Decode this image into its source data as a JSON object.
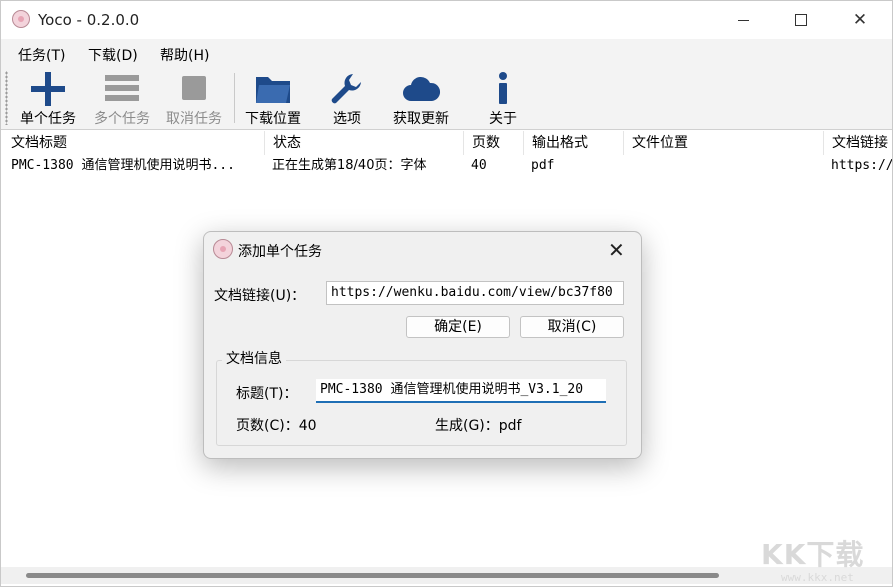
{
  "window": {
    "title": "Yoco - 0.2.0.0"
  },
  "menu": [
    "任务(T)",
    "下载(D)",
    "帮助(H)"
  ],
  "toolbar": {
    "single_task": "单个任务",
    "multi_task": "多个任务",
    "cancel_task": "取消任务",
    "download_location": "下载位置",
    "options": "选项",
    "get_updates": "获取更新",
    "about": "关于"
  },
  "table": {
    "headers": [
      "文档标题",
      "状态",
      "页数",
      "输出格式",
      "文件位置",
      "文档链接"
    ],
    "rows": [
      [
        "PMC-1380 通信管理机使用说明书...",
        "正在生成第18/40页：字体",
        "40",
        "pdf",
        "",
        "https://"
      ]
    ]
  },
  "dialog": {
    "title": "添加单个任务",
    "url_label": "文档链接(U)：",
    "url_value": "https://wenku.baidu.com/view/bc37f80",
    "ok_label": "确定(E)",
    "cancel_label": "取消(C)",
    "group_title": "文档信息",
    "title_label": "标题(T)：",
    "title_value": "PMC-1380 通信管理机使用说明书_V3.1_20",
    "pages_text": "页数(C)：40",
    "format_text": "生成(G)：pdf"
  },
  "watermark": {
    "main": "KK下载",
    "url": "www.kkx.net"
  },
  "colors": {
    "accent": "#1f6fb5",
    "icon_blue": "#1e4a8a",
    "disabled": "#8c8c8c"
  }
}
